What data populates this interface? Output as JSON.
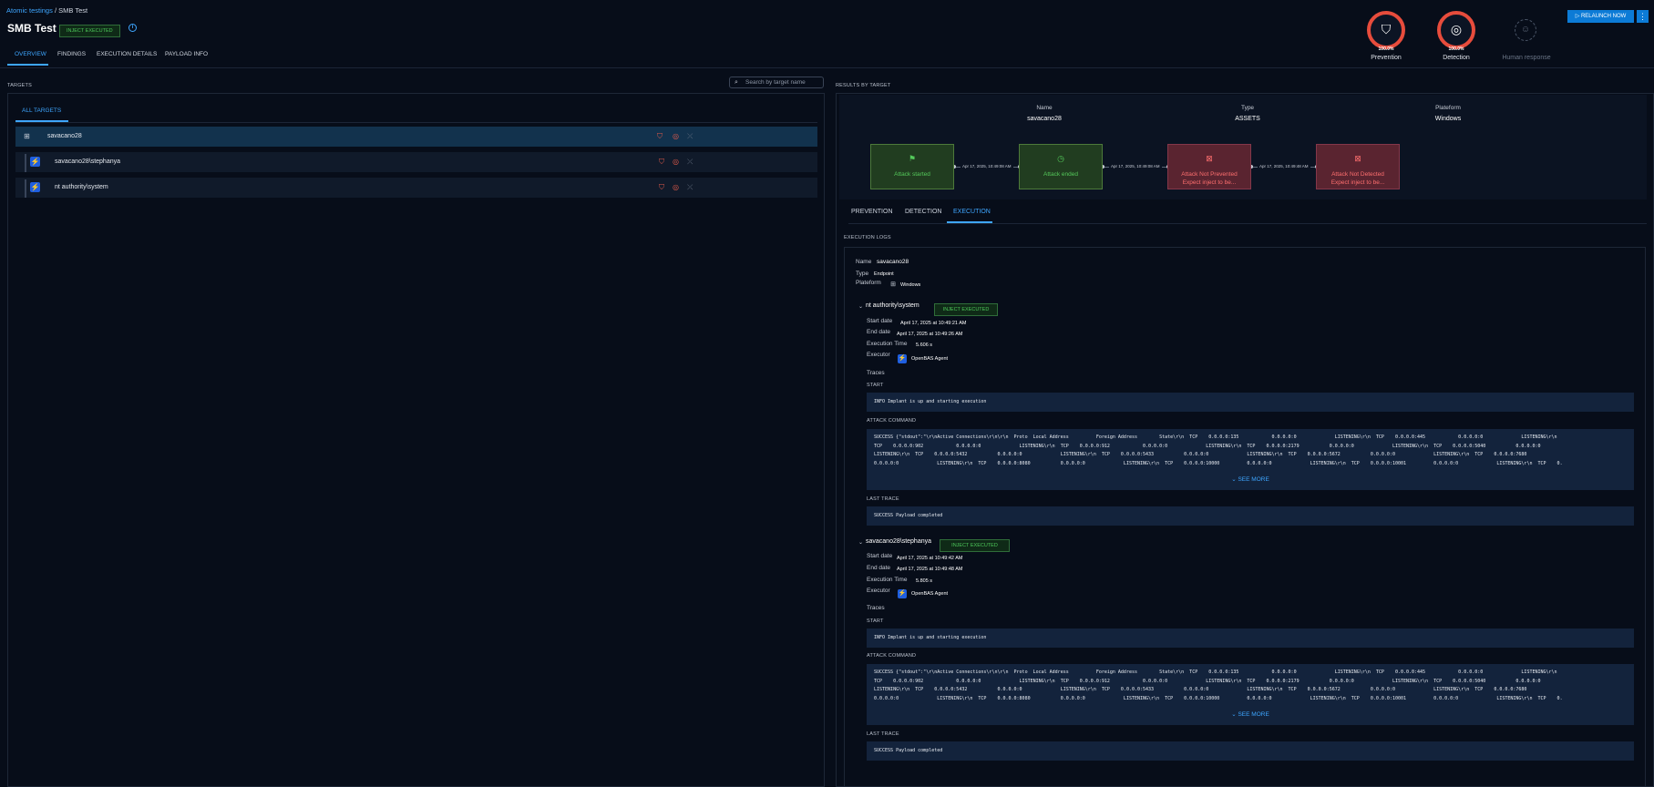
{
  "breadcrumb": {
    "parent": "Atomic testings",
    "sep": "/",
    "current": "SMB Test"
  },
  "header": {
    "title": "SMB Test",
    "status": "INJECT EXECUTED",
    "tabs": [
      "OVERVIEW",
      "FINDINGS",
      "EXECUTION DETAILS",
      "PAYLOAD INFO"
    ],
    "active_tab": "OVERVIEW"
  },
  "gauges": [
    {
      "label": "Prevention",
      "value": "100.0%",
      "icon": "shield-icon",
      "color": "#e74c3c",
      "level": 1.0
    },
    {
      "label": "Detection",
      "value": "100.0%",
      "icon": "target-icon",
      "color": "#e74c3c",
      "level": 1.0
    },
    {
      "label": "Human response",
      "value": "",
      "icon": "human-response-icon",
      "color": "#4a5567"
    }
  ],
  "actions": {
    "relaunch": "RELAUNCH NOW",
    "more": "⋮"
  },
  "targets": {
    "heading": "TARGETS",
    "search_placeholder": "Search by target name",
    "all_targets": "ALL TARGETS",
    "rows": [
      {
        "name": "savacano28",
        "icon": "windows-icon",
        "selected": true
      },
      {
        "name": "savacano28\\stephanya",
        "icon": "agent-icon",
        "selected": false
      },
      {
        "name": "nt authority\\system",
        "icon": "agent-icon",
        "selected": false
      }
    ]
  },
  "results": {
    "heading": "RESULTS BY TARGET",
    "info": {
      "name_label": "Name",
      "name": "savacano28",
      "type_label": "Type",
      "type": "ASSETS",
      "platform_label": "Plateform",
      "platform": "Windows"
    },
    "timeline": [
      {
        "label": "Attack started",
        "status": "ok",
        "icon": "flag-icon"
      },
      {
        "label": "Attack ended",
        "status": "ok",
        "icon": "clock-icon"
      },
      {
        "label": "Attack Not Prevented\nExpect inject to be...",
        "status": "ko",
        "icon": "alert-icon"
      },
      {
        "label": "Attack Not Detected\nExpect inject to be...",
        "status": "ko",
        "icon": "alert-icon"
      }
    ],
    "timeline_connectors": [
      "Apr 17, 2025, 10:49:08 AM",
      "Apr 17, 2025, 10:49:08 AM",
      "Apr 17, 2025, 10:49:48 AM"
    ],
    "tabs": [
      "PREVENTION",
      "DETECTION",
      "EXECUTION"
    ],
    "active_tab": "EXECUTION"
  },
  "execution_logs": {
    "heading": "EXECUTION LOGS",
    "endpoint": {
      "name_label": "Name",
      "name": "savacano28",
      "type_label": "Type",
      "type": "Endpoint",
      "platform_label": "Plateform",
      "platform": "Windows"
    },
    "labels": {
      "start_date": "Start date",
      "end_date": "End date",
      "execution_time": "Execution Time",
      "executor": "Executor",
      "traces": "Traces",
      "start": "START",
      "attack_command": "ATTACK COMMAND",
      "last_trace": "LAST TRACE",
      "see_more": "SEE MORE"
    },
    "agents": [
      {
        "name": "nt authority\\system",
        "status": "INJECT EXECUTED",
        "start_date": "April 17, 2025 at 10:49:21 AM",
        "end_date": "April 17, 2025 at 10:49:26 AM",
        "execution_time": "5.606 s",
        "executor": "OpenBAS Agent",
        "start_trace": "INFO Implant is up and starting execution",
        "command_lines": [
          "SUCCESS {\"stdout\":\"\\r\\nActive Connections\\r\\n\\r\\n  Proto  Local Address          Foreign Address        State\\r\\n  TCP    0.0.0.0:135            0.0.0.0:0              LISTENING\\r\\n  TCP    0.0.0.0:445            0.0.0.0:0              LISTENING\\r\\n",
          "TCP    0.0.0.0:902            0.0.0.0:0              LISTENING\\r\\n  TCP    0.0.0.0:912            0.0.0.0:0              LISTENING\\r\\n  TCP    0.0.0.0:2179           0.0.0.0:0              LISTENING\\r\\n  TCP    0.0.0.0:5040           0.0.0.0:0",
          "LISTENING\\r\\n  TCP    0.0.0.0:5432           0.0.0.0:0              LISTENING\\r\\n  TCP    0.0.0.0:5433           0.0.0.0:0              LISTENING\\r\\n  TCP    0.0.0.0:5672           0.0.0.0:0              LISTENING\\r\\n  TCP    0.0.0.0:7680",
          "0.0.0.0:0              LISTENING\\r\\n  TCP    0.0.0.0:8080           0.0.0.0:0              LISTENING\\r\\n  TCP    0.0.0.0:10000          0.0.0.0:0              LISTENING\\r\\n  TCP    0.0.0.0:10001          0.0.0.0:0              LISTENING\\r\\n  TCP    0."
        ],
        "last_trace": "SUCCESS Payload completed"
      },
      {
        "name": "savacano28\\stephanya",
        "status": "INJECT EXECUTED",
        "start_date": "April 17, 2025 at 10:49:42 AM",
        "end_date": "April 17, 2025 at 10:49:48 AM",
        "execution_time": "5.805 s",
        "executor": "OpenBAS Agent",
        "start_trace": "INFO Implant is up and starting execution",
        "command_lines": [
          "SUCCESS {\"stdout\":\"\\r\\nActive Connections\\r\\n\\r\\n  Proto  Local Address          Foreign Address        State\\r\\n  TCP    0.0.0.0:135            0.0.0.0:0              LISTENING\\r\\n  TCP    0.0.0.0:445            0.0.0.0:0              LISTENING\\r\\n",
          "TCP    0.0.0.0:902            0.0.0.0:0              LISTENING\\r\\n  TCP    0.0.0.0:912            0.0.0.0:0              LISTENING\\r\\n  TCP    0.0.0.0:2179           0.0.0.0:0              LISTENING\\r\\n  TCP    0.0.0.0:5040           0.0.0.0:0",
          "LISTENING\\r\\n  TCP    0.0.0.0:5432           0.0.0.0:0              LISTENING\\r\\n  TCP    0.0.0.0:5433           0.0.0.0:0              LISTENING\\r\\n  TCP    0.0.0.0:5672           0.0.0.0:0              LISTENING\\r\\n  TCP    0.0.0.0:7680",
          "0.0.0.0:0              LISTENING\\r\\n  TCP    0.0.0.0:8080           0.0.0.0:0              LISTENING\\r\\n  TCP    0.0.0.0:10000          0.0.0.0:0              LISTENING\\r\\n  TCP    0.0.0.0:10001          0.0.0.0:0              LISTENING\\r\\n  TCP    0."
        ],
        "last_trace": "SUCCESS Payload completed"
      }
    ]
  }
}
